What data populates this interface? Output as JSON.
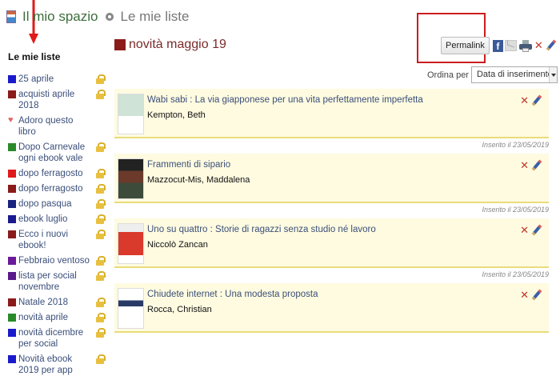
{
  "header": {
    "breadcrumb_root": "Il mio spazio",
    "breadcrumb_current": "Le mie liste"
  },
  "sidebar": {
    "title": "Le mie liste",
    "items": [
      {
        "label": "25 aprile",
        "color": "#1a1acc",
        "locked": true,
        "icon": "swatch"
      },
      {
        "label": "acquisti aprile 2018",
        "color": "#8b1a1a",
        "locked": true,
        "icon": "swatch"
      },
      {
        "label": "Adoro questo libro",
        "color": "#e06666",
        "locked": false,
        "icon": "heart-icon"
      },
      {
        "label": "Dopo Carnevale ogni ebook vale",
        "color": "#2a8a2a",
        "locked": true,
        "icon": "swatch"
      },
      {
        "label": "dopo ferragosto",
        "color": "#e01a1a",
        "locked": true,
        "icon": "swatch"
      },
      {
        "label": "dopo ferragosto",
        "color": "#8b1a1a",
        "locked": true,
        "icon": "swatch"
      },
      {
        "label": "dopo pasqua",
        "color": "#1a237e",
        "locked": true,
        "icon": "swatch"
      },
      {
        "label": "ebook luglio",
        "color": "#1a1a8e",
        "locked": true,
        "icon": "swatch"
      },
      {
        "label": "Ecco i nuovi ebook!",
        "color": "#8b1a1a",
        "locked": true,
        "icon": "swatch"
      },
      {
        "label": "Febbraio ventoso",
        "color": "#6a1a9a",
        "locked": true,
        "icon": "swatch"
      },
      {
        "label": "lista per social novembre",
        "color": "#5a1a8a",
        "locked": true,
        "icon": "swatch"
      },
      {
        "label": "Natale 2018",
        "color": "#8b1a1a",
        "locked": true,
        "icon": "swatch"
      },
      {
        "label": "novità aprile",
        "color": "#2a8a2a",
        "locked": true,
        "icon": "swatch"
      },
      {
        "label": "novità dicembre per social",
        "color": "#1a1acc",
        "locked": true,
        "icon": "swatch"
      },
      {
        "label": "Novità ebook 2019 per app",
        "color": "#1a1acc",
        "locked": true,
        "icon": "swatch"
      }
    ]
  },
  "list": {
    "title": "novità maggio 19",
    "color": "#8b1a1a"
  },
  "toolbar": {
    "permalink_label": "Permalink",
    "facebook_glyph": "f"
  },
  "sort": {
    "label": "Ordina per",
    "selected": "Data di inserimento"
  },
  "items": [
    {
      "title": "Wabi sabi : La via giapponese per una vita perfettamente imperfetta",
      "author": "Kempton, Beth",
      "inserted": "Inserito il 23/05/2019"
    },
    {
      "title": "Frammenti di sipario",
      "author": "Mazzocut-Mis, Maddalena",
      "inserted": "Inserito il 23/05/2019"
    },
    {
      "title": "Uno su quattro : Storie di ragazzi senza studio né lavoro",
      "author": "Niccolò Zancan",
      "inserted": "Inserito il 23/05/2019"
    },
    {
      "title": "Chiudete internet : Una modesta proposta",
      "author": "Rocca, Christian",
      "inserted": ""
    }
  ]
}
